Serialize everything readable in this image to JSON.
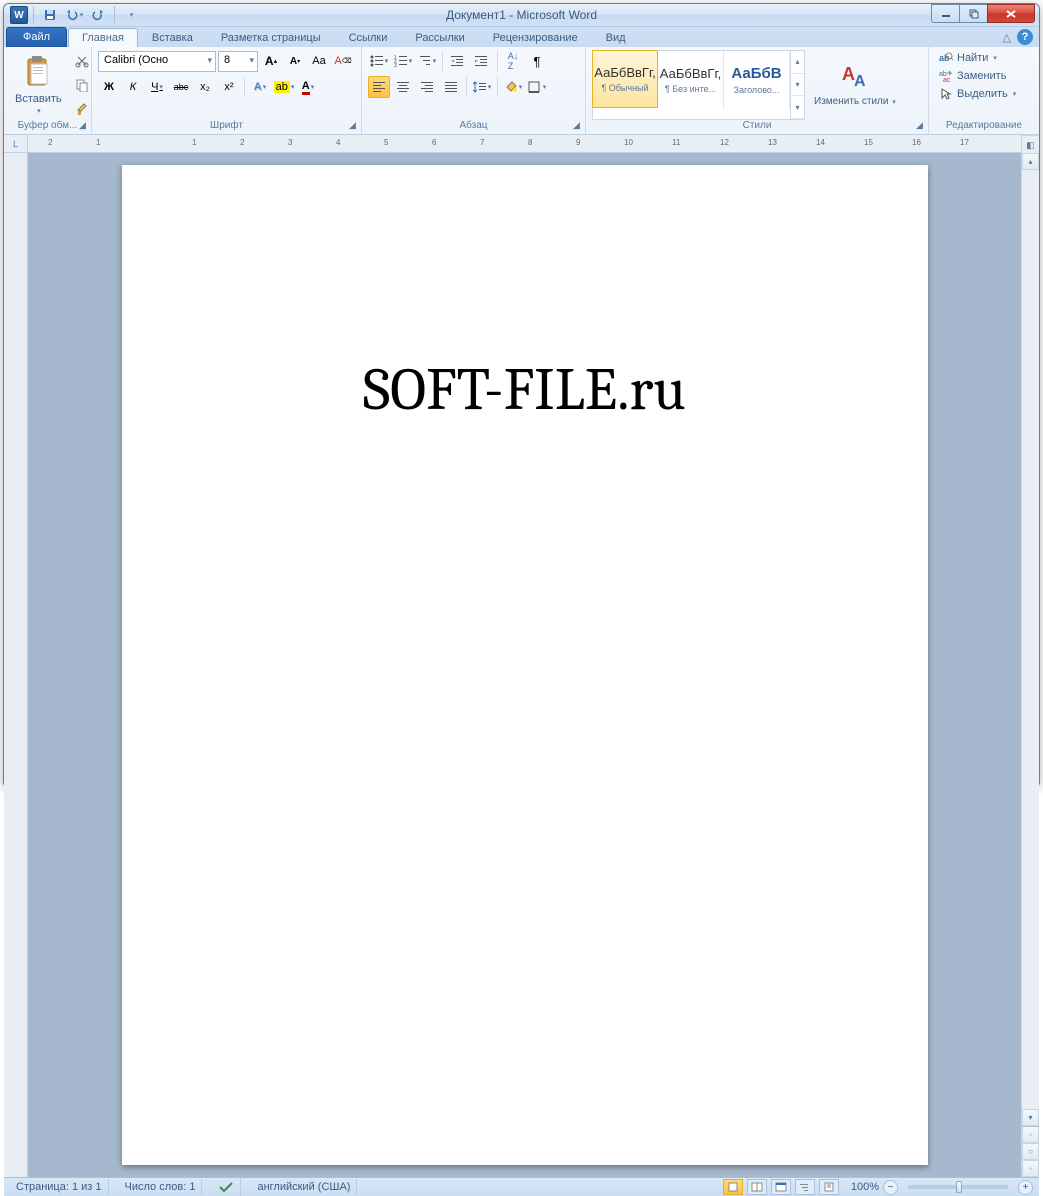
{
  "title": "Документ1  -  Microsoft Word",
  "tabs": {
    "file": "Файл",
    "items": [
      "Главная",
      "Вставка",
      "Разметка страницы",
      "Ссылки",
      "Рассылки",
      "Рецензирование",
      "Вид"
    ],
    "active": 0
  },
  "groups": {
    "clipboard": {
      "label": "Буфер обм...",
      "paste": "Вставить"
    },
    "font": {
      "label": "Шрифт",
      "name": "Calibri (Осно",
      "size": "8",
      "bold": "Ж",
      "italic": "К",
      "underline": "Ч",
      "strike": "abc",
      "sub": "x₂",
      "sup": "x²",
      "case": "Aa",
      "clear": "⌫"
    },
    "paragraph": {
      "label": "Абзац"
    },
    "styles": {
      "label": "Стили",
      "items": [
        {
          "preview": "АаБбВвГг,",
          "name": "¶ Обычный",
          "selected": true
        },
        {
          "preview": "АаБбВвГг,",
          "name": "¶ Без инте...",
          "selected": false
        },
        {
          "preview": "АаБбВ",
          "name": "Заголово...",
          "selected": false,
          "color": "#2a5a9a"
        }
      ],
      "change": "Изменить стили"
    },
    "editing": {
      "label": "Редактирование",
      "find": "Найти",
      "replace": "Заменить",
      "select": "Выделить"
    }
  },
  "document": {
    "text": "SOFT-FILE.ru"
  },
  "statusbar": {
    "page": "Страница: 1 из 1",
    "words": "Число слов: 1",
    "lang": "английский (США)",
    "zoom": "100%"
  },
  "ruler_marks": [
    "2",
    "1",
    "",
    "1",
    "2",
    "3",
    "4",
    "5",
    "6",
    "7",
    "8",
    "9",
    "10",
    "11",
    "12",
    "13",
    "14",
    "15",
    "16",
    "17"
  ]
}
